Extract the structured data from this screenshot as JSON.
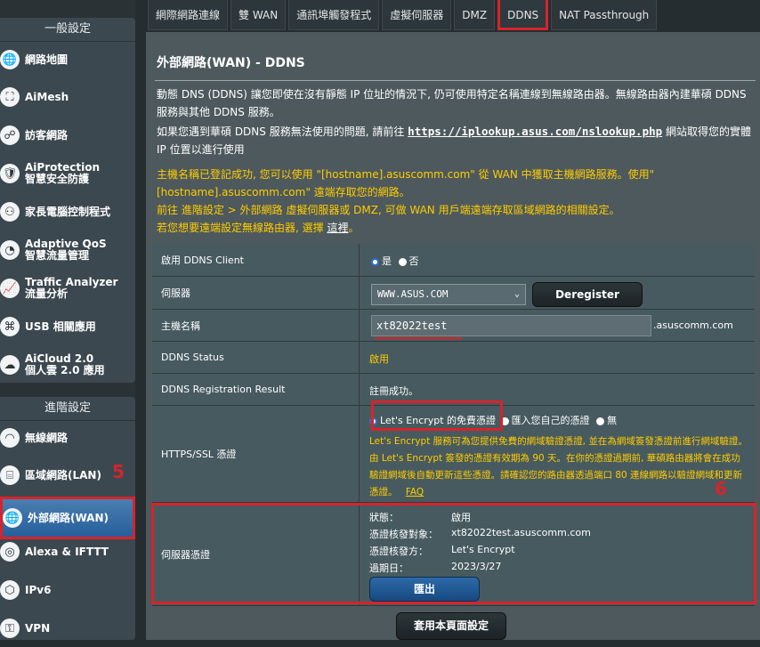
{
  "sidebar": {
    "general_header": "一般設定",
    "general_items": [
      {
        "label": "網路地圖",
        "icon": "globe-icon"
      },
      {
        "label": "AiMesh",
        "icon": "aimesh-icon"
      },
      {
        "label": "訪客網路",
        "icon": "guest-network-icon"
      },
      {
        "label": "AiProtection\n智慧安全防護",
        "icon": "shield-icon"
      },
      {
        "label": "家長電腦控制程式",
        "icon": "parental-control-icon"
      },
      {
        "label": "Adaptive QoS\n智慧流量管理",
        "icon": "qos-gauge-icon"
      },
      {
        "label": "Traffic Analyzer\n流量分析",
        "icon": "traffic-chart-icon"
      },
      {
        "label": "USB 相關應用",
        "icon": "usb-puzzle-icon"
      },
      {
        "label": "AiCloud 2.0\n個人雲 2.0 應用",
        "icon": "cloud-icon"
      }
    ],
    "advanced_header": "進階設定",
    "advanced_items": [
      {
        "label": "無線網路",
        "icon": "wifi-icon"
      },
      {
        "label": "區域網路(LAN)",
        "icon": "lan-icon"
      },
      {
        "label": "外部網路(WAN)",
        "icon": "wan-globe-icon"
      },
      {
        "label": "Alexa & IFTTT",
        "icon": "alexa-icon"
      },
      {
        "label": "IPv6",
        "icon": "ipv6-icon"
      },
      {
        "label": "VPN",
        "icon": "vpn-icon"
      }
    ]
  },
  "tabs": [
    "網際網路連線",
    "雙 WAN",
    "通訊埠觸發程式",
    "虛擬伺服器",
    "DMZ",
    "DDNS",
    "NAT Passthrough"
  ],
  "page_title": "外部網路(WAN) - DDNS",
  "description": {
    "line1": "動態 DNS (DDNS) 讓您即使在沒有靜態 IP 位址的情況下, 仍可使用特定名稱連線到無線路由器。無線路由器內建華碩 DDNS 服務與其他 DDNS 服務。",
    "line2_prefix": "如果您遇到華碩 DDNS 服務無法使用的問題, 請前往",
    "line2_url": "https://iplookup.asus.com/nslookup.php",
    "line2_suffix": "網站取得您的實體 IP 位置以進行使用"
  },
  "notice": {
    "line1_a": "主機名稱已登記成功, 您可以使用 \"[hostname].asuscomm.com\" 從 WAN 中獲取主機網路服務。使用\"[hostname].asuscomm.com\" 遠端存取您的網路。",
    "line2": "前往 進階設定 > 外部網路 虛擬伺服器或 DMZ, 可做 WAN 用戶端遠端存取區域網路的相關設定。",
    "line3_prefix": "若您想要遠端設定無線路由器, 選擇",
    "line3_link": "這裡",
    "line3_suffix": "。"
  },
  "form": {
    "enable_label": "啟用 DDNS Client",
    "enable_yes": "是",
    "enable_no": "否",
    "server_label": "伺服器",
    "server_value": "WWW.ASUS.COM",
    "deregister_button": "Deregister",
    "hostname_label": "主機名稱",
    "hostname_value": "xt82022test",
    "hostname_suffix": ".asuscomm.com",
    "status_label": "DDNS Status",
    "status_value": "啟用",
    "result_label": "DDNS Registration Result",
    "result_value": "註冊成功。",
    "https_label": "HTTPS/SSL 憑證",
    "https_opt1": "Let's Encrypt 的免費憑證",
    "https_opt2": "匯入您自己的憑證",
    "https_opt3": "無",
    "https_desc": "Let's Encrypt 服務可為您提供免費的網域驗證憑證, 並在為網域簽發憑證前進行網域驗證。由 Let's Encrypt 簽發的憑證有效期為 90 天。在你的憑證過期前, 華碩路由器將會在成功驗證網域後自動更新這些憑證。請確認您的路由器透過端口 80 連線網路以驗證網域和更新憑證。",
    "https_faq": "FAQ",
    "cert_label": "伺服器憑證",
    "cert_status_k": "狀態：",
    "cert_status_v": "啟用",
    "cert_subject_k": "憑證核發對象：",
    "cert_subject_v": "xt82022test.asuscomm.com",
    "cert_issuer_k": "憑證核發方：",
    "cert_issuer_v": "Let's Encrypt",
    "cert_expire_k": "過期日：",
    "cert_expire_v": "2023/3/27",
    "export_button": "匯出",
    "apply_button": "套用本頁面設定"
  },
  "annotations": {
    "step5": "5",
    "step6": "6"
  },
  "colors": {
    "highlight": "#d8232a",
    "notice": "#ffcc00",
    "active_nav": "#255f9b"
  }
}
